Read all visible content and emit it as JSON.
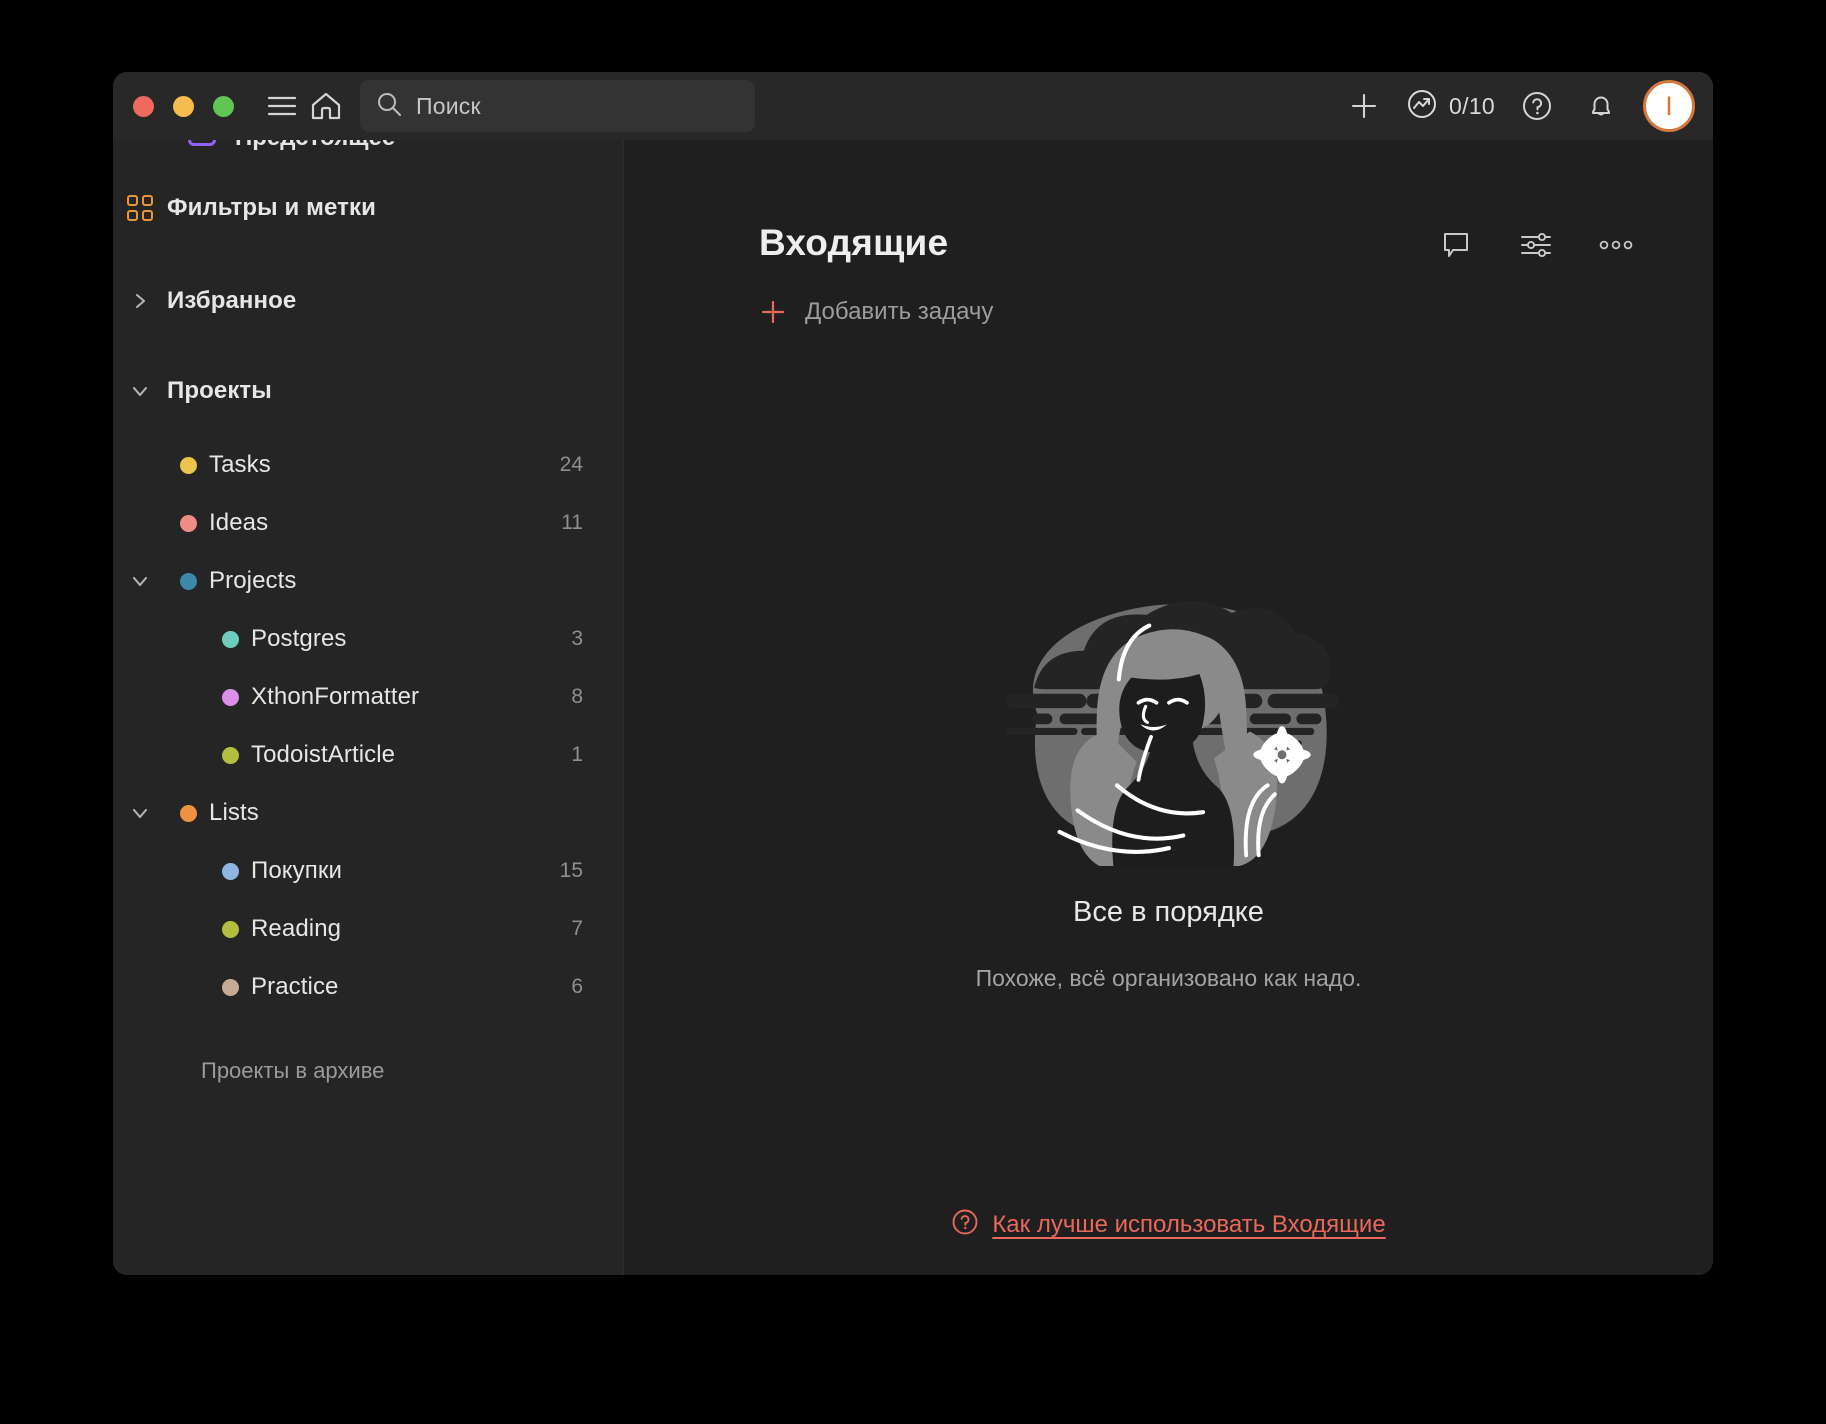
{
  "titlebar": {
    "traffic_lights": [
      "close",
      "minimize",
      "maximize"
    ],
    "menu_icon": "hamburger-icon",
    "home_icon": "home-icon",
    "search": {
      "placeholder": "Поиск",
      "value": "",
      "icon": "search-icon"
    },
    "add_icon": "plus-icon",
    "productivity": {
      "icon": "trending-up-icon",
      "value": "0/10"
    },
    "help_icon": "question-circle-icon",
    "notifications_icon": "bell-icon",
    "avatar": {
      "initial": "I",
      "border_color": "#d4793e",
      "bg_color": "#ffffff"
    }
  },
  "sidebar": {
    "cut_item": {
      "label": "Предстоящее",
      "icon_color": "#9163f5"
    },
    "filters": {
      "label": "Фильтры и метки",
      "icon": "grid-icon",
      "icon_color": "#e8963a"
    },
    "favorites": {
      "label": "Избранное",
      "state": "collapsed",
      "chevron": "chevron-right-icon"
    },
    "projects_header": {
      "label": "Проекты",
      "state": "expanded",
      "chevron": "chevron-down-icon"
    },
    "projects": [
      {
        "label": "Tasks",
        "count": "24",
        "color": "#eac44c",
        "level": 1,
        "chevron": ""
      },
      {
        "label": "Ideas",
        "count": "11",
        "color": "#ef8c84",
        "level": 1,
        "chevron": ""
      },
      {
        "label": "Projects",
        "count": "",
        "color": "#3c88aa",
        "level": 1,
        "chevron": "chevron-down-icon"
      },
      {
        "label": "Postgres",
        "count": "3",
        "color": "#6fcbbb",
        "level": 2,
        "chevron": ""
      },
      {
        "label": "XthonFormatter",
        "count": "8",
        "color": "#d990e6",
        "level": 2,
        "chevron": ""
      },
      {
        "label": "TodoistArticle",
        "count": "1",
        "color": "#b3bd3f",
        "level": 2,
        "chevron": ""
      },
      {
        "label": "Lists",
        "count": "",
        "color": "#ef9240",
        "level": 1,
        "chevron": "chevron-down-icon"
      },
      {
        "label": "Покупки",
        "count": "15",
        "color": "#8fb5e0",
        "level": 2,
        "chevron": ""
      },
      {
        "label": "Reading",
        "count": "7",
        "color": "#b3bd3f",
        "level": 2,
        "chevron": ""
      },
      {
        "label": "Practice",
        "count": "6",
        "color": "#c5ab96",
        "level": 2,
        "chevron": ""
      }
    ],
    "archive_label": "Проекты в архиве"
  },
  "main": {
    "title": "Входящие",
    "actions": {
      "comments": "comment-bubble-icon",
      "view_options": "sliders-icon",
      "more": "more-horizontal-icon"
    },
    "add_task_label": "Добавить задачу",
    "empty_state": {
      "illustration": "woman-with-flower-illustration",
      "heading": "Все в порядке",
      "subtext": "Похоже, всё организовано как надо."
    },
    "footer_link": {
      "icon": "question-circle-icon",
      "label": "Как лучше использовать Входящие",
      "color": "#e8685c"
    }
  }
}
